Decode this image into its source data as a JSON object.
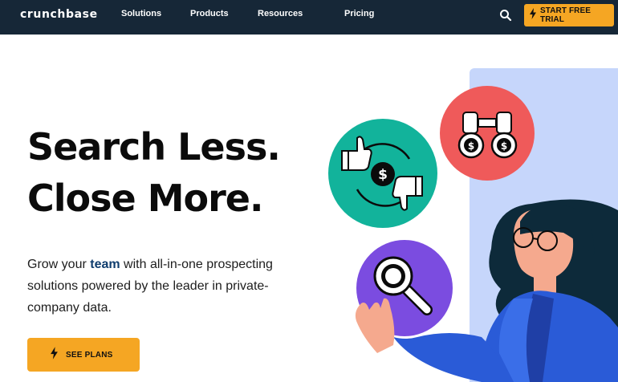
{
  "nav": {
    "logo": "crunchbase",
    "links": [
      "Solutions",
      "Products",
      "Resources",
      "Pricing"
    ],
    "cta": "START FREE TRIAL"
  },
  "hero": {
    "line1": "Search Less.",
    "line2": "Close More.",
    "sub_before": "Grow your ",
    "sub_highlight": "team",
    "sub_after": " with all-in-one prospecting solutions powered by the leader in private-company data.",
    "cta": "SEE PLANS"
  },
  "colors": {
    "nav_bg": "#162737",
    "accent": "#f5a623",
    "teal": "#12b39b",
    "coral": "#ef5a5a",
    "purple": "#7b4ce0",
    "panel": "#c6d6fb",
    "jacket": "#2a5bd7"
  },
  "icons": [
    "search-icon",
    "lightning-icon",
    "thumbs-up-icon",
    "thumbs-down-icon",
    "dollar-icon",
    "binoculars-icon",
    "magnifier-icon"
  ]
}
